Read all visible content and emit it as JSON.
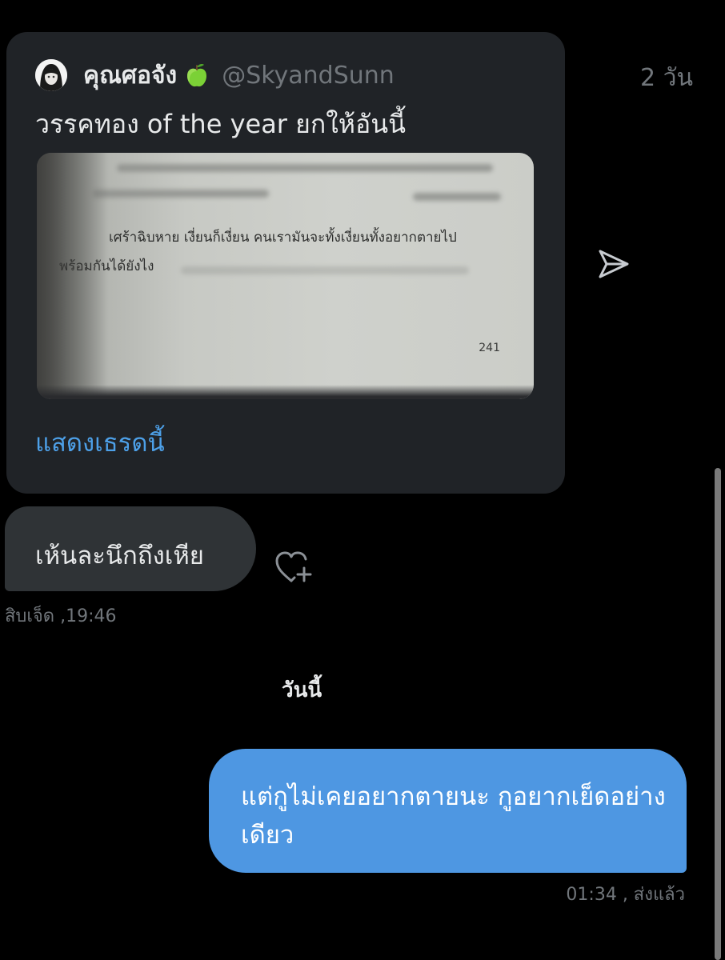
{
  "quoted_tweet": {
    "display_name": "คุณศอจัง",
    "name_emoji": "green-apple",
    "handle": "@SkyandSunn",
    "time": "2 วัน",
    "text": "วรรคทอง of the year ยกให้อันนี้",
    "image": {
      "description_icon": "book-page-photo",
      "book_line_1": "เศร้าฉิบหาย เงี่ยนก็เงี่ยน คนเรามันจะทั้งเงี่ยนทั้งอยากตายไป",
      "book_line_2": "พร้อมกันได้ยังไง",
      "page_number": "241"
    },
    "show_thread_label": "แสดงเธรดนี้"
  },
  "share_icon": "share-send-icon",
  "incoming_message": {
    "text": "เห้นละนึกถึงเหีย",
    "meta": "สิบเจ็ด ,19:46",
    "react_icon": "heart-plus-icon"
  },
  "day_divider": "วันนี้",
  "outgoing_message": {
    "text": "แต่กูไม่เคยอยากตายนะ กูอยากเย็ดอย่างเดียว",
    "meta": "01:34 , ส่งแล้ว"
  },
  "colors": {
    "background": "#000000",
    "card": "#202327",
    "incoming_bubble": "#2f3336",
    "outgoing_bubble": "#4e97e2",
    "link": "#4da0e8",
    "muted": "#71767b"
  }
}
